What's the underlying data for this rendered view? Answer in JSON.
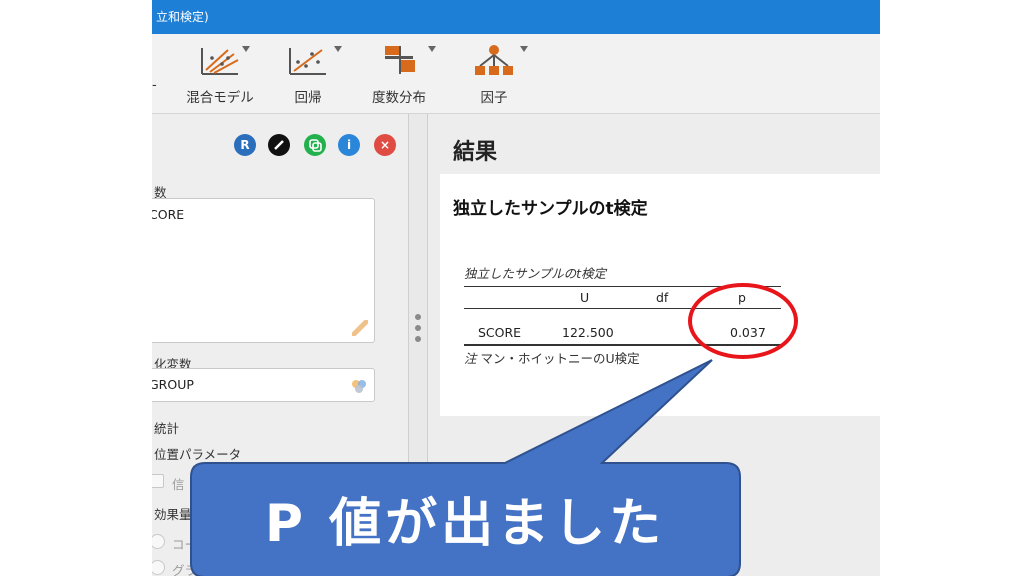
{
  "window": {
    "title": "立和検定)"
  },
  "ribbon": {
    "items": [
      {
        "label": "混合モデル",
        "icon": "mixed-model-icon"
      },
      {
        "label": "回帰",
        "icon": "regression-icon"
      },
      {
        "label": "度数分布",
        "icon": "frequencies-icon"
      },
      {
        "label": "因子",
        "icon": "factor-icon"
      }
    ],
    "left_edge_label": "-"
  },
  "left_panel": {
    "buttons": [
      {
        "label": "R",
        "icon": "r-icon",
        "color": "#2a6ebc"
      },
      {
        "label": "",
        "icon": "edit-icon",
        "color": "#111111"
      },
      {
        "label": "",
        "icon": "copy-icon",
        "color": "#22b14c"
      },
      {
        "label": "i",
        "icon": "info-icon",
        "color": "#2a86d8"
      },
      {
        "label": "×",
        "icon": "close-icon",
        "color": "#e04b43"
      }
    ],
    "dependent_label": "数",
    "dependent_value": "CORE",
    "grouping_label": "化変数",
    "grouping_value": "GROUP",
    "stats_label": "統計",
    "location_label": "位置パラメータ",
    "truncated_1": "信",
    "effect_label": "効果量",
    "truncated_2": "コー",
    "truncated_3": "グラ"
  },
  "results": {
    "heading": "結果",
    "card_title": "独立したサンプルのt検定",
    "table_caption_a": "独立したサンプルの",
    "table_caption_t": "t",
    "table_caption_b": "検定",
    "columns": [
      "U",
      "df",
      "p"
    ],
    "row": {
      "name": "SCORE",
      "U": "122.500",
      "df": "",
      "p": "0.037"
    },
    "note_prefix": "注",
    "note_text": "マン・ホイットニーのU検定"
  },
  "callout": {
    "text": "P 値が出ました",
    "fill": "#4472c4",
    "ring_color": "#e8161b"
  }
}
